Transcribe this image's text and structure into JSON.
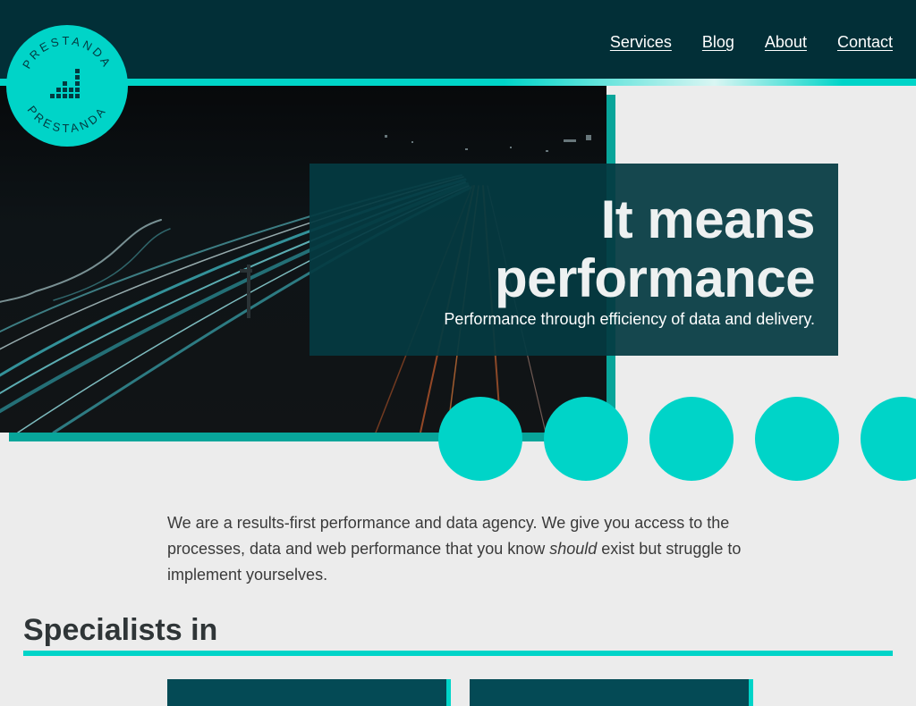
{
  "brand": {
    "logo_text_top": "PRESTANDA",
    "logo_text_bottom": "PRESTANDA"
  },
  "nav": {
    "items": [
      {
        "label": "Services"
      },
      {
        "label": "Blog"
      },
      {
        "label": "About"
      },
      {
        "label": "Contact"
      }
    ]
  },
  "hero": {
    "title": "It means performance",
    "subtitle": "Performance through efficiency of data and delivery."
  },
  "intro": {
    "text_before": "We are a results-first performance and data agency. We give you access to the processes, data and web performance that you know ",
    "emphasis": "should",
    "text_after": " exist but struggle to implement yourselves."
  },
  "specialists": {
    "heading": "Specialists in"
  },
  "colors": {
    "header_bg": "#022f37",
    "accent": "#00d4c8",
    "hero_box": "#043a42",
    "page_bg": "#ececec"
  },
  "icons": {
    "logo_mark": "bar-chart-dots-icon"
  }
}
